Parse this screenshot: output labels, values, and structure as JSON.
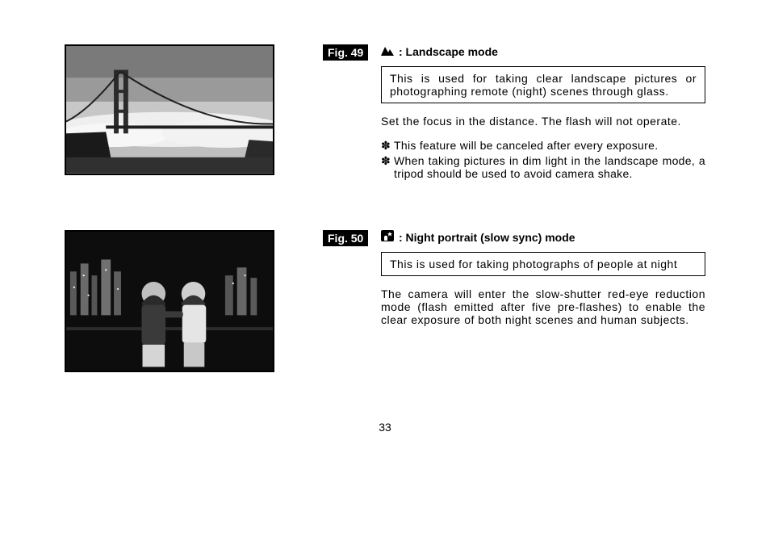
{
  "sections": [
    {
      "figLabel": "Fig. 49",
      "iconName": "landscape-icon",
      "heading": ": Landscape mode",
      "box": "This is used for taking clear landscape pictures or photographing remote (night) scenes through glass.",
      "para": "Set the focus in the distance.  The flash will not operate.",
      "bullets": [
        "This feature will be canceled after every exposure.",
        "When taking pictures in dim light in the landscape mode, a tripod should be used to avoid camera shake."
      ]
    },
    {
      "figLabel": "Fig. 50",
      "iconName": "night-portrait-icon",
      "heading": ": Night portrait (slow sync) mode",
      "box": "This is used for taking photographs of people at night",
      "para": "The camera will enter the slow-shutter red-eye reduction mode (flash emitted after five pre-flashes) to enable the clear exposure of both night scenes and human subjects.",
      "bullets": []
    }
  ],
  "bulletMark": "✽",
  "pageNumber": "33"
}
